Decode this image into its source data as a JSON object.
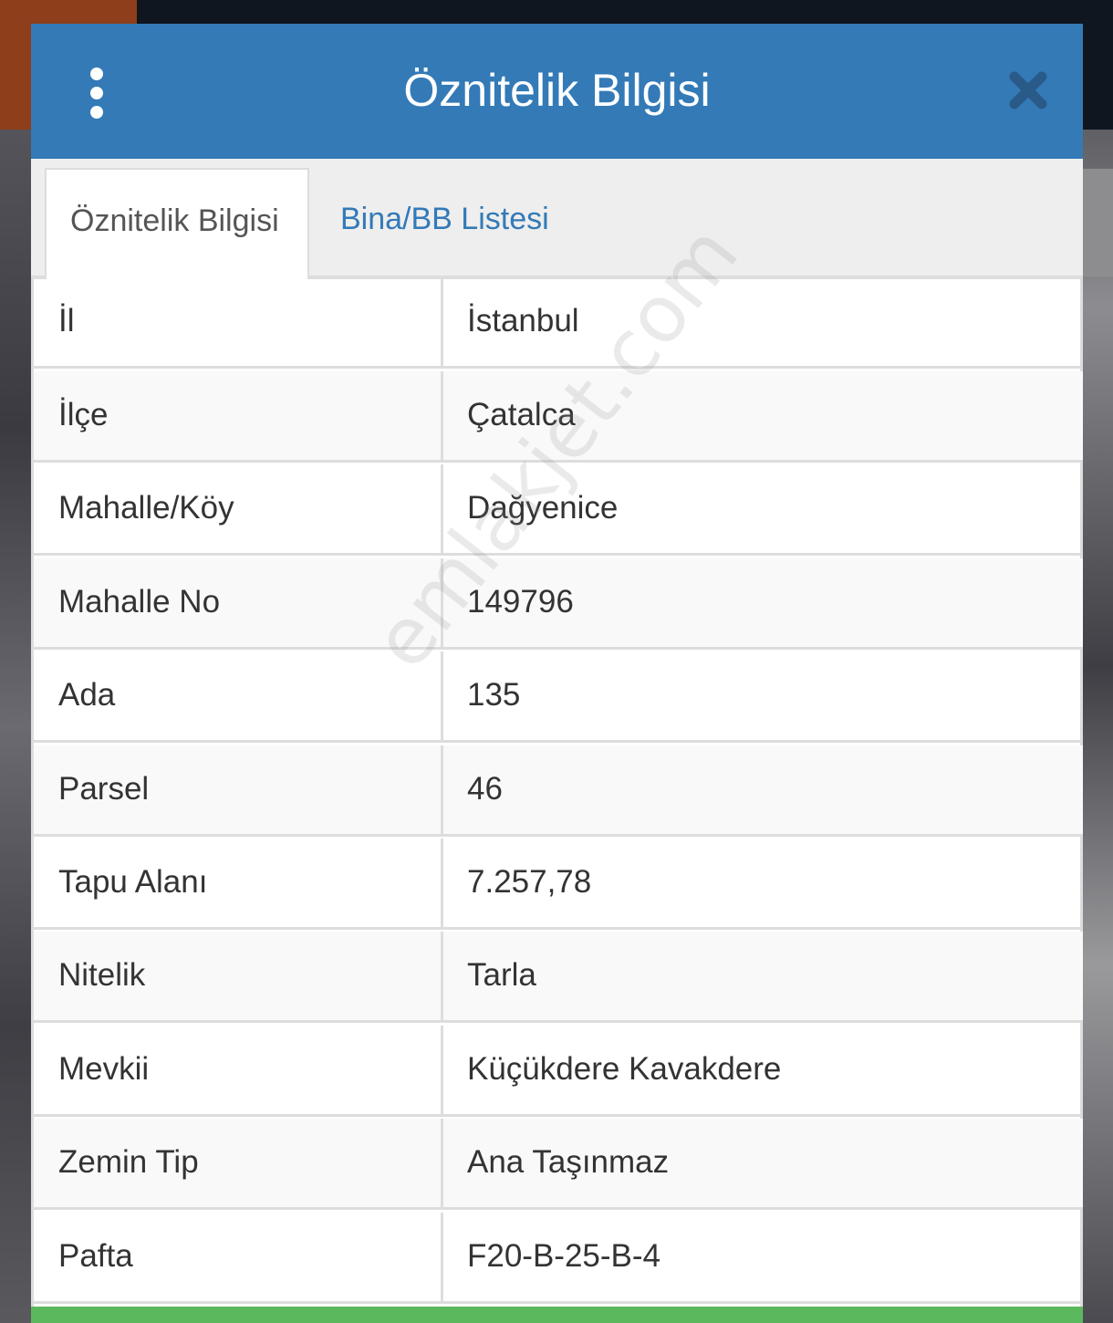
{
  "dialog": {
    "title": "Öznitelik Bilgisi",
    "menu_icon": "vertical-ellipsis-icon",
    "close_icon": "close-x-icon"
  },
  "tabs": [
    {
      "label": "Öznitelik Bilgisi",
      "active": true
    },
    {
      "label": "Bina/BB Listesi",
      "active": false
    }
  ],
  "attributes": [
    {
      "key": "İl",
      "value": "İstanbul"
    },
    {
      "key": "İlçe",
      "value": "Çatalca"
    },
    {
      "key": "Mahalle/Köy",
      "value": "Dağyenice"
    },
    {
      "key": "Mahalle No",
      "value": "149796"
    },
    {
      "key": "Ada",
      "value": "135"
    },
    {
      "key": "Parsel",
      "value": "46"
    },
    {
      "key": "Tapu Alanı",
      "value": "7.257,78"
    },
    {
      "key": "Nitelik",
      "value": "Tarla"
    },
    {
      "key": "Mevkii",
      "value": "Küçükdere Kavakdere"
    },
    {
      "key": "Zemin Tip",
      "value": "Ana Taşınmaz"
    },
    {
      "key": "Pafta",
      "value": "F20-B-25-B-4"
    }
  ],
  "watermark": "emlakjet.com",
  "colors": {
    "header": "#337ab7",
    "tab_link": "#337ab7",
    "footer_bar": "#5cb85c"
  }
}
